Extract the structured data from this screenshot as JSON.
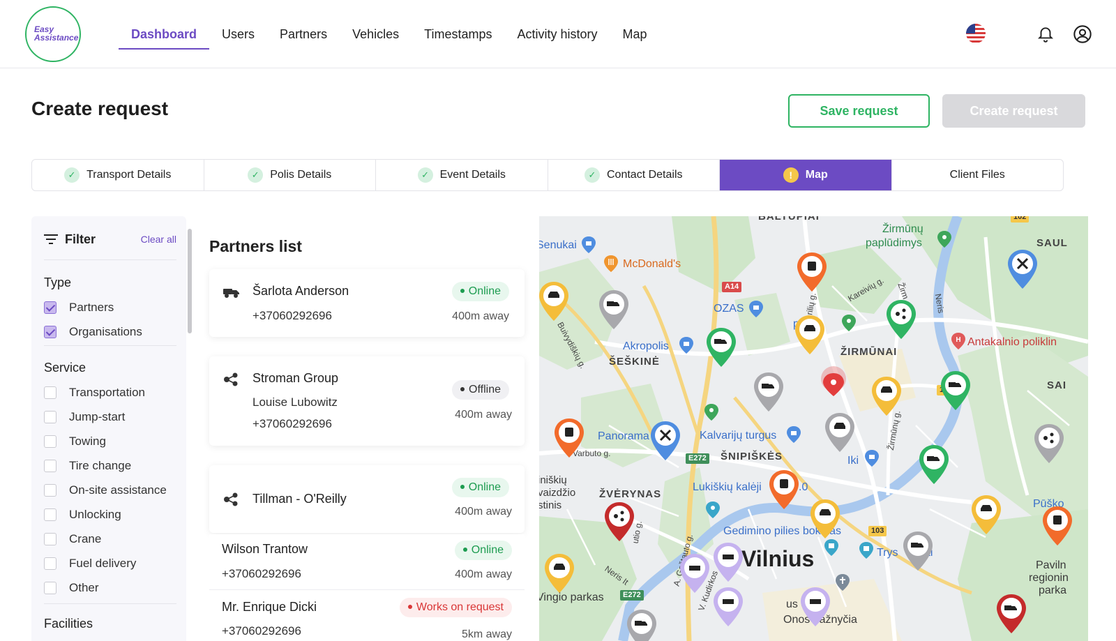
{
  "header": {
    "logo_line1": "Easy",
    "logo_line2": "Assistance",
    "nav": [
      "Dashboard",
      "Users",
      "Partners",
      "Vehicles",
      "Timestamps",
      "Activity history",
      "Map"
    ],
    "active_nav": "Dashboard"
  },
  "page": {
    "title": "Create request",
    "save_label": "Save request",
    "create_label": "Create request"
  },
  "steps": [
    {
      "label": "Transport Details",
      "state": "done"
    },
    {
      "label": "Polis Details",
      "state": "done"
    },
    {
      "label": "Event Details",
      "state": "done"
    },
    {
      "label": "Contact Details",
      "state": "done"
    },
    {
      "label": "Map",
      "state": "warning"
    },
    {
      "label": "Client Files",
      "state": "none"
    }
  ],
  "filter": {
    "title": "Filter",
    "clear_label": "Clear all",
    "type_label": "Type",
    "types": [
      {
        "label": "Partners",
        "checked": true
      },
      {
        "label": "Organisations",
        "checked": true
      }
    ],
    "service_label": "Service",
    "services": [
      {
        "label": "Transportation",
        "checked": false
      },
      {
        "label": "Jump-start",
        "checked": false
      },
      {
        "label": "Towing",
        "checked": false
      },
      {
        "label": "Tire change",
        "checked": false
      },
      {
        "label": "On-site assistance",
        "checked": false
      },
      {
        "label": "Unlocking",
        "checked": false
      },
      {
        "label": "Crane",
        "checked": false
      },
      {
        "label": "Fuel delivery",
        "checked": false
      },
      {
        "label": "Other",
        "checked": false
      }
    ],
    "facilities_label": "Facilities"
  },
  "partners": {
    "title": "Partners list",
    "items": [
      {
        "icon": "tow-truck-icon",
        "name": "Šarlota Anderson",
        "phone": "+37060292696",
        "status": "Online",
        "distance": "400m away"
      },
      {
        "icon": "organisation-icon",
        "name": "Stroman Group",
        "contact": "Louise Lubowitz",
        "phone": "+37060292696",
        "status": "Offline",
        "distance": "400m away"
      },
      {
        "icon": "organisation-icon",
        "name": "Tillman - O'Reilly",
        "status": "Online",
        "distance": "400m away"
      },
      {
        "name": "Wilson Trantow",
        "phone": "+37060292696",
        "status": "Online",
        "distance": "400m away"
      },
      {
        "name": "Mr. Enrique Dicki",
        "phone": "+37060292696",
        "status": "Works on request",
        "distance": "5km away"
      }
    ]
  },
  "map": {
    "labels": {
      "baltupiai": "BALTUPIAI",
      "zirmunu_pludimys_1": "Žirmūnų",
      "zirmunu_pludimys_2": "paplūdimys",
      "saul": "SAUL",
      "senukai": "Senukai",
      "mcdonalds": "McDonald's",
      "ozas": "OZAS",
      "akropolis": "Akropolis",
      "seskine": "ŠEŠKINĖ",
      "zirmunai": "ŽIRMŪNAI",
      "antakalnio": "Antakalnio poliklin",
      "sai": "SAI",
      "panorama": "Panorama",
      "kalvariju": "Kalvarijų turgus",
      "snipiskes": "ŠNIPIŠKĖS",
      "iki": "Iki",
      "zverynas": "ŽVĖRYNAS",
      "lukiskiu": "Lukiškių kalėji",
      "gedimino": "Gedimino pilies bokštas",
      "vilnius": "Vilnius",
      "trys": "Trys",
      "vingio": "Vingio parkas",
      "onos": "Onos bažnyčia",
      "paviln_1": "Paviln",
      "paviln_2": "regionin",
      "paviln_3": "parka",
      "puk": "Pūško",
      "park_fragment": "park",
      "vaizdzio_1": "iniškių",
      "vaizdzio_2": "vaizdžio",
      "vaizdzio_3": "stinis",
      "lo_fragment": ".0",
      "ai_fragment": "ai",
      "us_sv": "us Šv.",
      "kareiviu": "Kareivių g.",
      "zirm": "Žirm",
      "zirmunu_g": "Žirmūnų g.",
      "neris": "Neris",
      "neris_it": "Neris It",
      "buivydiskiu": "Buivydiškių g.",
      "warbuto": "Varbuto g.",
      "gostauto": "A. Goštauto g.",
      "kudirkos": "V. Kudirkos",
      "utio": "utio g.",
      "birzu": "ėrilių g."
    },
    "roads": {
      "a14": "A14",
      "e272_1": "E272",
      "e272_2": "E272",
      "r102": "102",
      "r103": "103",
      "r102_top": "102"
    }
  },
  "colors": {
    "brand": "#6c4bc3",
    "success": "#2fb463",
    "warning": "#f5c74a",
    "danger": "#d93636"
  }
}
